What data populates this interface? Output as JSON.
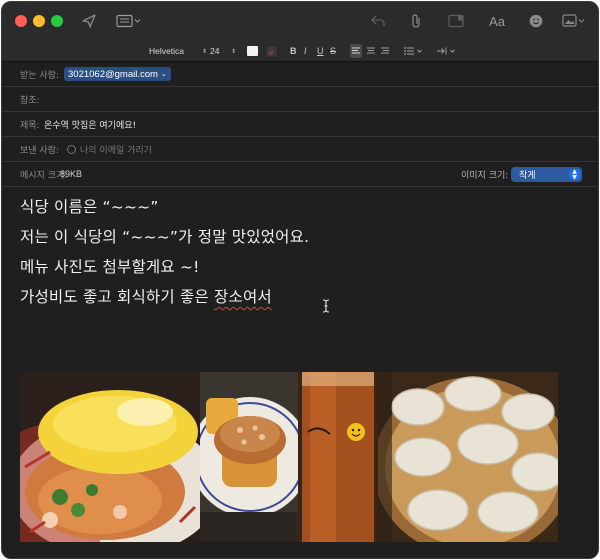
{
  "toolbar": {
    "icons": [
      "send-icon",
      "header-fields-icon",
      "reply-icon",
      "attach-icon",
      "browser-icon",
      "format-icon",
      "emoji-icon",
      "photo-icon"
    ],
    "format_label": "Aa"
  },
  "format_bar": {
    "font_family": "Helvetica",
    "font_size": "24",
    "bold": "B",
    "italic": "I",
    "underline": "U",
    "strike": "S"
  },
  "header": {
    "to_label": "받는 사람:",
    "to_value": "3021062@gmail.com",
    "cc_label": "참조:",
    "subject_label": "제목:",
    "subject_value": "온수역 맛집은 여기에요!",
    "from_label": "보낸 사람:",
    "from_placeholder": "나의 이메일 가리기",
    "message_size_label": "메시지 크기:",
    "message_size_value": "89KB",
    "image_size_label": "이미지 크기:",
    "image_size_value": "작게"
  },
  "body": {
    "lines": [
      "식당 이름은 “~~~”",
      "저는 이 식당의 “~~~”가 정말 맛있었어요.",
      "메뉴 사진도 첨부할게요 ~!",
      "가성비도 좋고 회식하기 좋은 "
    ],
    "misspelled": "장소여서"
  },
  "attachments": [
    "omelette-pasta-photo",
    "muffin-photo",
    "beer-photo",
    "dumplings-photo"
  ],
  "colors": {
    "window_bg": "#1f1f1f",
    "toolbar_bg": "#2b2b2b",
    "accent": "#2d5aa0",
    "spell_error": "#e0443d"
  }
}
